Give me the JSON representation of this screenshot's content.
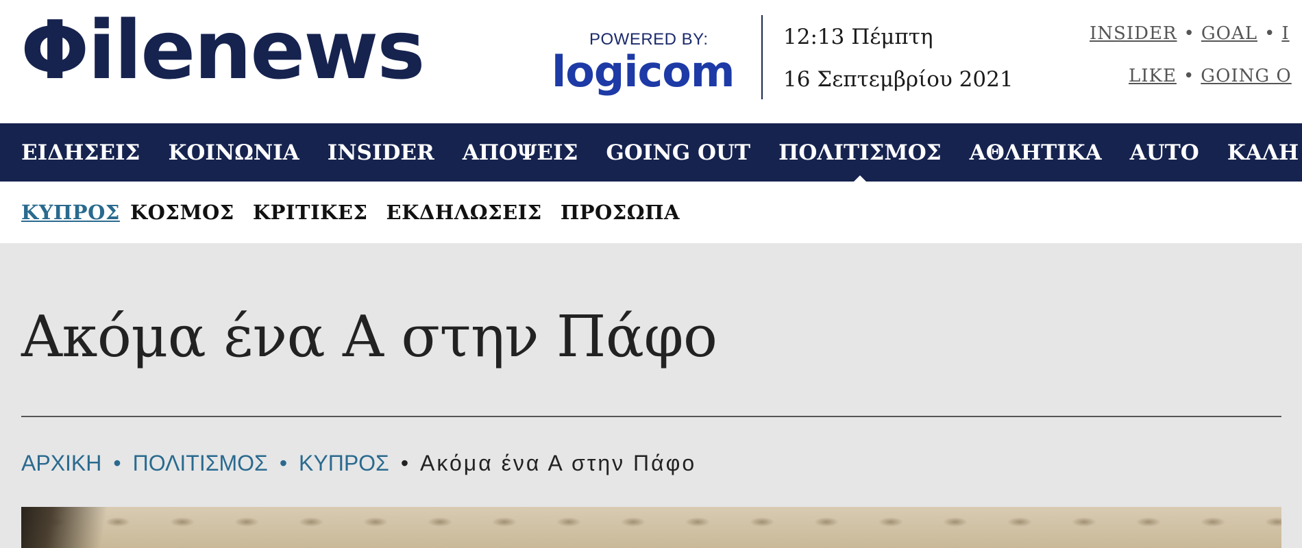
{
  "header": {
    "logo_text": "Φilenews",
    "powered_by": "POWERED BY:",
    "sponsor": "logicom",
    "time": "12:13 Πέμπτη",
    "date": "16 Σεπτεμβρίου 2021",
    "top_links_row1": [
      "INSIDER",
      "GOAL",
      "I"
    ],
    "top_links_row2": [
      "LIKE",
      "GOING O"
    ]
  },
  "main_nav": {
    "items": [
      "ΕΙΔΗΣΕΙΣ",
      "ΚΟΙΝΩΝΙΑ",
      "INSIDER",
      "ΑΠΟΨΕΙΣ",
      "GOING OUT",
      "ΠΟΛΙΤΙΣΜΟΣ",
      "ΑΘΛΗΤΙΚΑ",
      "AUTO",
      "ΚΑΛΗ Ζ"
    ],
    "active": "ΠΟΛΙΤΙΣΜΟΣ"
  },
  "sub_nav": {
    "items": [
      "ΚΥΠΡΟΣ",
      "ΚΟΣΜΟΣ",
      "ΚΡΙΤΙΚΕΣ",
      "ΕΚΔΗΛΩΣΕΙΣ",
      "ΠΡΟΣΩΠΑ"
    ],
    "active": "ΚΥΠΡΟΣ"
  },
  "article": {
    "title": "Ακόμα ένα Α στην Πάφο",
    "breadcrumb": [
      "ΑΡΧΙΚΗ",
      "ΠΟΛΙΤΙΣΜΟΣ",
      "ΚΥΠΡΟΣ"
    ],
    "breadcrumb_current": "Ακόμα ένα Α στην Πάφο",
    "breadcrumb_separator": "•"
  },
  "colors": {
    "brand_navy": "#16234f",
    "link_blue": "#2a6a8e",
    "sponsor_blue": "#1d3aa6",
    "page_bg": "#e6e6e7"
  }
}
